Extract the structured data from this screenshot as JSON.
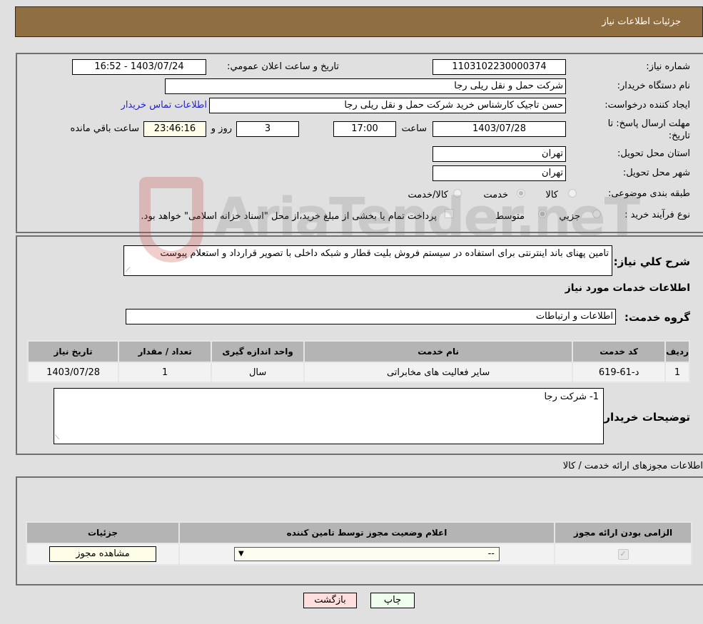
{
  "header": {
    "title": "جزئیات اطلاعات نیاز"
  },
  "form": {
    "need_number_label": "شماره نیاز:",
    "need_number": "1103102230000374",
    "announce_label": "تاریخ و ساعت اعلان عمومي:",
    "announce_value": "1403/07/24 - 16:52",
    "buyer_org_label": "نام دستگاه خریدار:",
    "buyer_org": "شرکت حمل و نقل ریلی رجا",
    "creator_label": "ایجاد کننده درخواست:",
    "creator": "حسن تاجیک کارشناس خرید شرکت حمل و نقل ریلی رجا",
    "contact_link": "اطلاعات تماس خریدار",
    "deadline_label": "مهلت ارسال پاسخ: تا تاریخ:",
    "deadline_date": "1403/07/28",
    "time_label": "ساعت",
    "deadline_time": "17:00",
    "days": "3",
    "days_label": "روز و",
    "remaining": "23:46:16",
    "remaining_label": "ساعت باقي مانده",
    "province_label": "استان محل تحویل:",
    "province": "تهران",
    "city_label": "شهر محل تحویل:",
    "city": "تهران",
    "category_label": "طبقه بندی موضوعی:",
    "category_options": [
      "کالا",
      "خدمت",
      "کالا/خدمت"
    ],
    "category_selected": "خدمت",
    "process_label": "نوع فرآیند خرید :",
    "process_options": [
      "جزیي",
      "متوسط"
    ],
    "process_selected": "متوسط",
    "treasury_note": "پرداخت تمام یا بخشی از مبلغ خرید،از محل \"اسناد خزانه اسلامی\" خواهد بود."
  },
  "description": {
    "label": "شرح کلي نیاز:",
    "text": "تامین پهنای باند اینترنتی برای استفاده در سیستم فروش بلیت قطار و شبکه داخلی با تصویر قرارداد و استعلام پیوست"
  },
  "services": {
    "section_title": "اطلاعات خدمات مورد نیاز",
    "group_label": "گروه خدمت:",
    "group_value": "اطلاعات و ارتباطات",
    "columns": [
      "ردیف",
      "کد خدمت",
      "نام خدمت",
      "واحد اندازه گیری",
      "تعداد / مقدار",
      "تاریخ نیاز"
    ],
    "rows": [
      {
        "row": "1",
        "code": "د-61-619",
        "name": "سایر فعالیت های مخابراتی",
        "unit": "سال",
        "qty": "1",
        "date": "1403/07/28"
      }
    ]
  },
  "buyer_notes": {
    "label": "توضیحات خریدار:",
    "text": "1- شرکت رجا"
  },
  "permits": {
    "section_title": "اطلاعات مجوزهای ارائه خدمت / کالا",
    "columns": [
      "الزامی بودن ارائه مجوز",
      "اعلام وضعیت مجوز توسط تامین کننده",
      "جزئیات"
    ],
    "rows": [
      {
        "required": true,
        "status_value": "--",
        "details_button": "مشاهده مجوز"
      }
    ]
  },
  "buttons": {
    "print": "چاپ",
    "back": "بازگشت"
  },
  "watermark": "AriaTender.neT"
}
